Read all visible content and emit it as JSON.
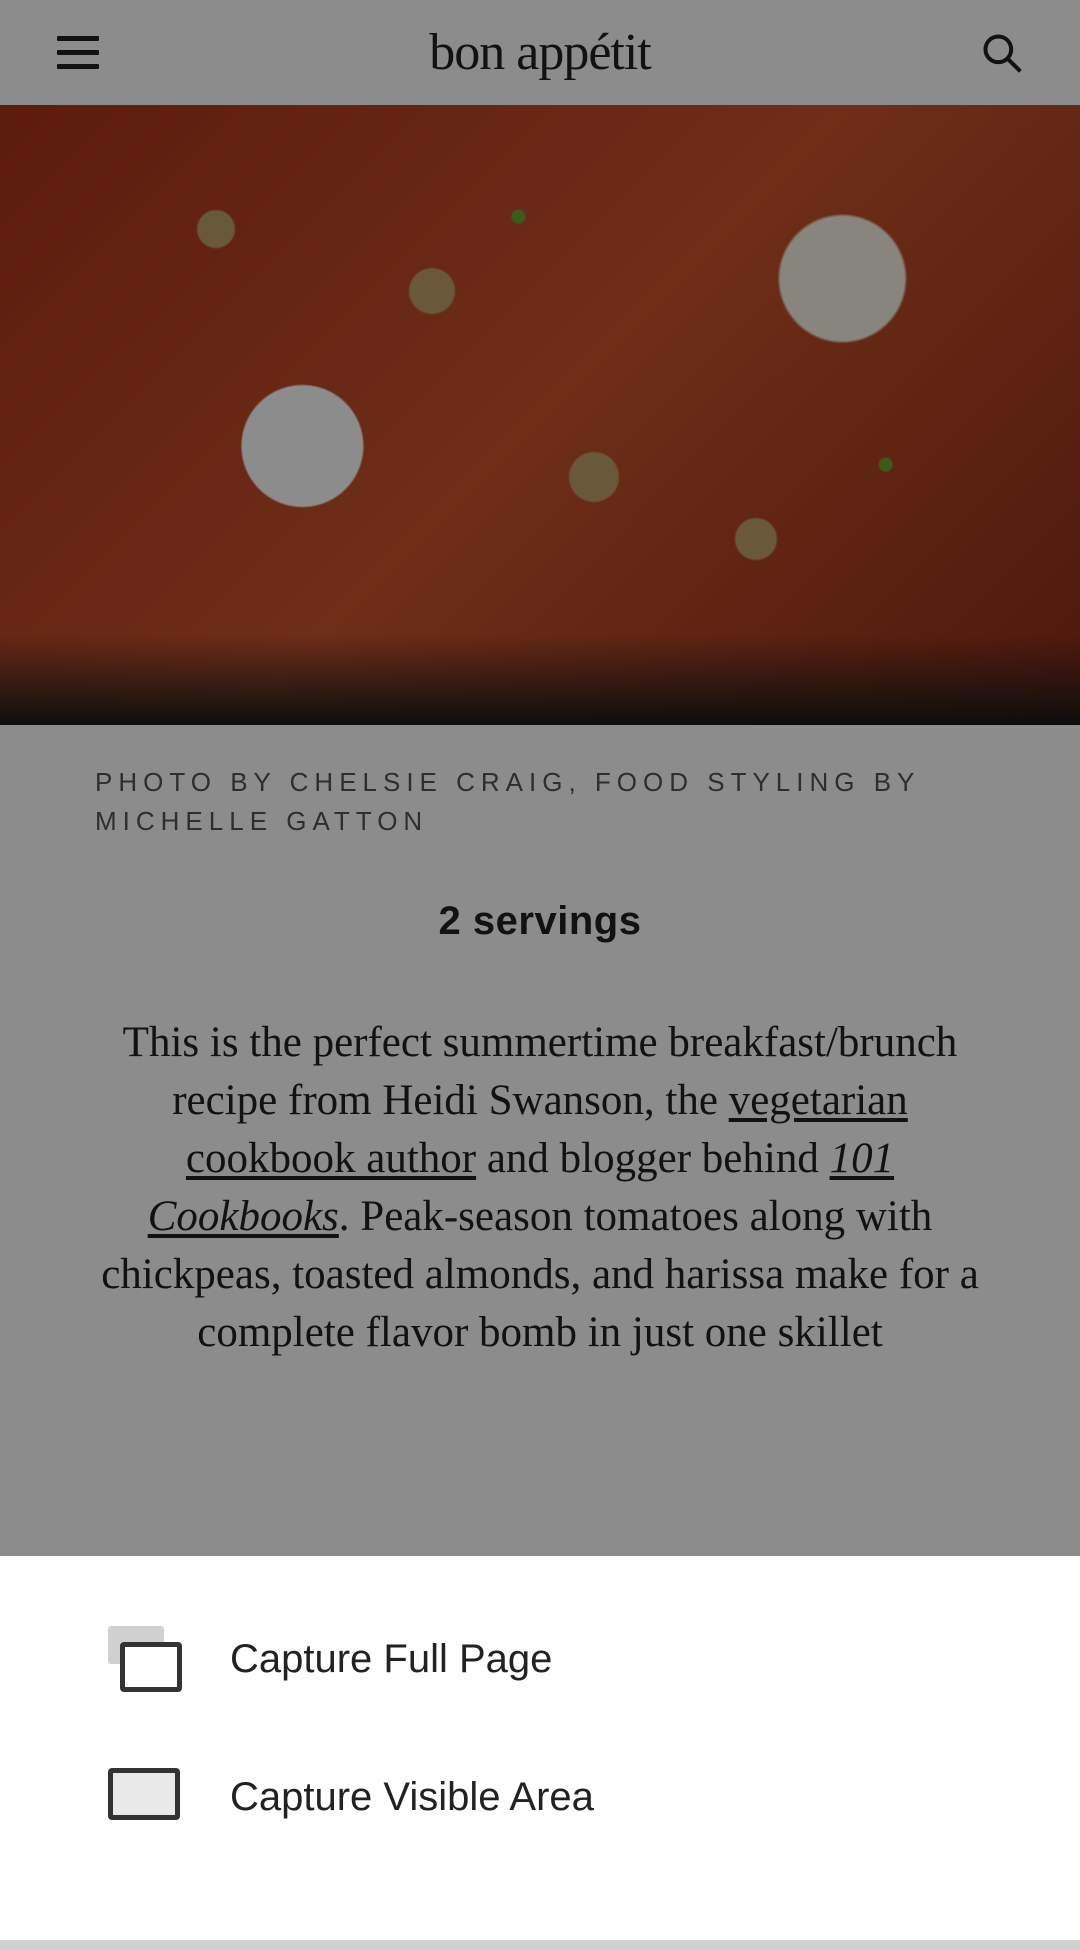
{
  "header": {
    "logo_text": "bon appétit"
  },
  "hero": {
    "caption": "PHOTO BY CHELSIE CRAIG, FOOD STYLING BY MICHELLE GATTON"
  },
  "servings": "2 servings",
  "description": {
    "part1": "This is the perfect summertime breakfast/brunch recipe from Heidi Swanson, the ",
    "link1": "vegetarian cookbook author",
    "part2": " and blogger behind ",
    "link2": "101 Cookbooks",
    "part3": ". Peak-season tomatoes along with chickpeas, toasted almonds, and harissa make for a complete flavor bomb in just one skillet"
  },
  "bottom_sheet": {
    "option1": "Capture Full Page",
    "option2": "Capture Visible Area"
  }
}
